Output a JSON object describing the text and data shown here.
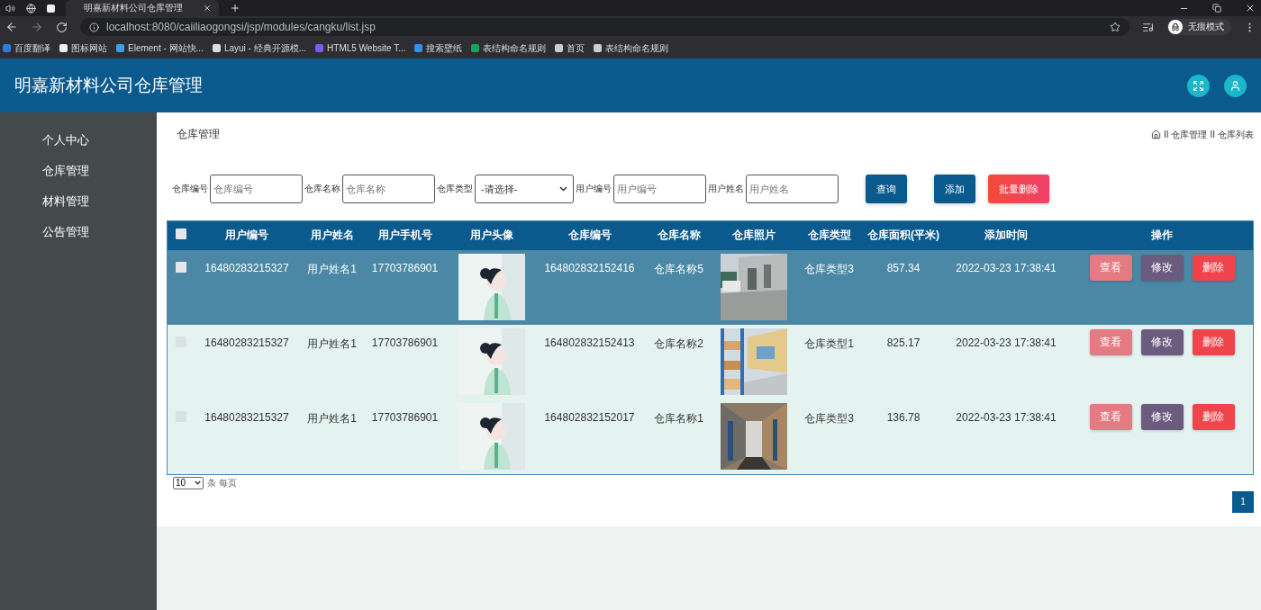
{
  "browser": {
    "tab_title": "明嘉新材料公司仓库管理",
    "url": "localhost:8080/caiiliaogongsi/jsp/modules/cangku/list.jsp",
    "profile": "无痕模式",
    "bookmarks": [
      "百度翻译",
      "图标网站",
      "Element - 网站快...",
      "Layui - 经典开源模...",
      "HTML5 Website T...",
      "搜索壁纸",
      "表结构命名规则",
      "首页",
      "表结构命名规则"
    ]
  },
  "header": {
    "title": "明嘉新材料公司仓库管理"
  },
  "sidebar": {
    "items": [
      {
        "label": "个人中心",
        "selected": false
      },
      {
        "label": "仓库管理",
        "selected": false
      },
      {
        "label": "材料管理",
        "selected": false
      },
      {
        "label": "公告管理",
        "selected": false
      }
    ]
  },
  "page": {
    "title": "仓库管理",
    "breadcrumb": [
      "仓库管理",
      "仓库列表"
    ],
    "separators": [
      "II",
      "II"
    ]
  },
  "filters": [
    {
      "label": "仓库编号",
      "kind": "input",
      "placeholder": "仓库编号"
    },
    {
      "label": "仓库名称",
      "kind": "input",
      "placeholder": "仓库名称"
    },
    {
      "label": "仓库类型",
      "kind": "select",
      "value": "-请选择-"
    },
    {
      "label": "用户编号",
      "kind": "input",
      "placeholder": "用户编号"
    },
    {
      "label": "用户姓名",
      "kind": "input",
      "placeholder": "用户姓名"
    }
  ],
  "buttons": [
    {
      "label": "查询",
      "kind": "primary"
    },
    {
      "label": "添加",
      "kind": "primary"
    },
    {
      "label": "批量删除",
      "kind": "danger"
    }
  ],
  "table": {
    "all_checked": false,
    "columns": [
      "用户编号",
      "用户姓名",
      "用户手机号",
      "用户头像",
      "仓库编号",
      "仓库名称",
      "仓库照片",
      "仓库类型",
      "仓库面积(平米)",
      "添加时间",
      "操作"
    ],
    "rows": [
      {
        "selected": true,
        "checked": false,
        "user_no": "16480283215327",
        "user_name": "用户姓名1",
        "phone": "17703786901",
        "warehouse_no": "164802832152416",
        "warehouse_name": "仓库名称5",
        "type": "仓库类型3",
        "area": "857.34",
        "added": "2022-03-23 17:38:41",
        "actions": [
          "查看",
          "修改",
          "删除"
        ]
      },
      {
        "selected": false,
        "checked": false,
        "user_no": "16480283215327",
        "user_name": "用户姓名1",
        "phone": "17703786901",
        "warehouse_no": "164802832152413",
        "warehouse_name": "仓库名称2",
        "type": "仓库类型1",
        "area": "825.17",
        "added": "2022-03-23 17:38:41",
        "actions": [
          "查看",
          "修改",
          "删除"
        ]
      },
      {
        "selected": false,
        "checked": false,
        "user_no": "16480283215327",
        "user_name": "用户姓名1",
        "phone": "17703786901",
        "warehouse_no": "164802832152017",
        "warehouse_name": "仓库名称1",
        "type": "仓库类型3",
        "area": "136.78",
        "added": "2022-03-23 17:38:41",
        "actions": [
          "查看",
          "修改",
          "删除"
        ]
      }
    ]
  },
  "pager": {
    "page_size": "10",
    "per_page_text": "条 每页",
    "pages": [
      {
        "label": "1",
        "selected": true
      }
    ]
  }
}
